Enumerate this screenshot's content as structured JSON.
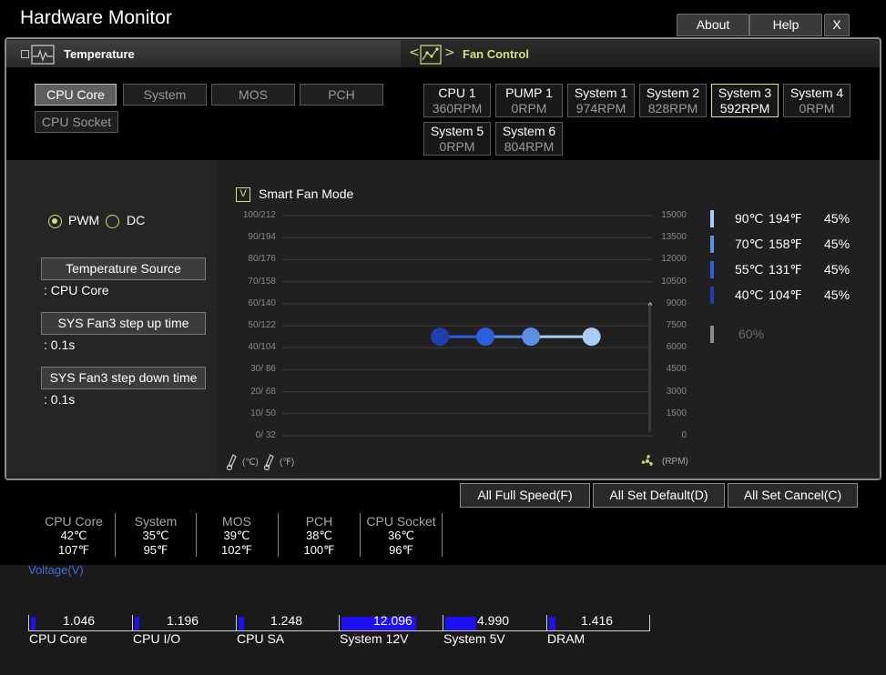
{
  "app": {
    "title": "Hardware Monitor"
  },
  "window_buttons": {
    "about": "About",
    "help": "Help",
    "close": "X"
  },
  "sections": {
    "temperature": "Temperature",
    "fan_control": "Fan Control",
    "fan_control_prev": "<",
    "fan_control_next": ">"
  },
  "temp_sources": [
    {
      "label": "CPU Core",
      "active": true
    },
    {
      "label": "System",
      "active": false
    },
    {
      "label": "MOS",
      "active": false
    },
    {
      "label": "PCH",
      "active": false
    },
    {
      "label": "CPU Socket",
      "active": false
    }
  ],
  "fans": [
    {
      "name": "CPU 1",
      "rpm": "360RPM"
    },
    {
      "name": "PUMP 1",
      "rpm": "0RPM"
    },
    {
      "name": "System 1",
      "rpm": "974RPM"
    },
    {
      "name": "System 2",
      "rpm": "828RPM"
    },
    {
      "name": "System 3",
      "rpm": "592RPM",
      "active": true
    },
    {
      "name": "System 4",
      "rpm": "0RPM"
    },
    {
      "name": "System 5",
      "rpm": "0RPM"
    },
    {
      "name": "System 6",
      "rpm": "804RPM"
    }
  ],
  "mode": {
    "pwm": "PWM",
    "dc": "DC",
    "selected": "PWM"
  },
  "smart_fan": {
    "label": "Smart Fan Mode",
    "checked": true,
    "check_glyph": "V"
  },
  "settings": {
    "temp_source_label": "Temperature Source",
    "temp_source_value": ": CPU Core",
    "step_up_label": "SYS Fan3 step up time",
    "step_up_value": ": 0.1s",
    "step_down_label": "SYS Fan3 step down time",
    "step_down_value": ": 0.1s"
  },
  "chart": {
    "y_left_ticks": [
      "100/212",
      "90/194",
      "80/176",
      "70/158",
      "60/140",
      "50/122",
      "40/104",
      "30/ 86",
      "20/ 68",
      "10/ 50",
      "0/ 32"
    ],
    "y_right_ticks": [
      "15000",
      "13500",
      "12000",
      "10500",
      "9000",
      "7500",
      "6000",
      "4500",
      "3000",
      "1500",
      "0"
    ],
    "unit_c": "(℃)",
    "unit_f": "(℉)",
    "unit_rpm": "(RPM)",
    "points": [
      {
        "temp_c": 40,
        "fan_pct": 45,
        "color": "#1f3fb0"
      },
      {
        "temp_c": 55,
        "fan_pct": 45,
        "color": "#2d5ee0"
      },
      {
        "temp_c": 70,
        "fan_pct": 45,
        "color": "#5b8fe8"
      },
      {
        "temp_c": 90,
        "fan_pct": 45,
        "color": "#a8ccf5"
      }
    ],
    "current_level_pct": 60
  },
  "legend": [
    {
      "c": "90℃",
      "f": "194℉",
      "pct": "45%",
      "color": "#a8ccf5"
    },
    {
      "c": "70℃",
      "f": "158℉",
      "pct": "45%",
      "color": "#5b8fe8"
    },
    {
      "c": "55℃",
      "f": "131℉",
      "pct": "45%",
      "color": "#2d5ee0"
    },
    {
      "c": "40℃",
      "f": "104℉",
      "pct": "45%",
      "color": "#1f3fb0"
    }
  ],
  "legend_extra": {
    "pct": "60%",
    "color": "#8a8a8a"
  },
  "actions": {
    "full_speed": "All Full Speed(F)",
    "set_default": "All Set Default(D)",
    "set_cancel": "All Set Cancel(C)"
  },
  "temperatures": [
    {
      "name": "CPU Core",
      "c": "42℃",
      "f": "107℉"
    },
    {
      "name": "System",
      "c": "35℃",
      "f": "95℉"
    },
    {
      "name": "MOS",
      "c": "39℃",
      "f": "102℉"
    },
    {
      "name": "PCH",
      "c": "38℃",
      "f": "100℉"
    },
    {
      "name": "CPU Socket",
      "c": "36℃",
      "f": "96℉"
    }
  ],
  "voltage": {
    "title": "Voltage(V)",
    "items": [
      {
        "name": "CPU Core",
        "value": "1.046",
        "fill_fraction": 0.05
      },
      {
        "name": "CPU I/O",
        "value": "1.196",
        "fill_fraction": 0.05
      },
      {
        "name": "CPU SA",
        "value": "1.248",
        "fill_fraction": 0.06
      },
      {
        "name": "System 12V",
        "value": "12.096",
        "fill_fraction": 0.85
      },
      {
        "name": "System 5V",
        "value": "4.990",
        "fill_fraction": 0.35
      },
      {
        "name": "DRAM",
        "value": "1.416",
        "fill_fraction": 0.07
      }
    ]
  }
}
